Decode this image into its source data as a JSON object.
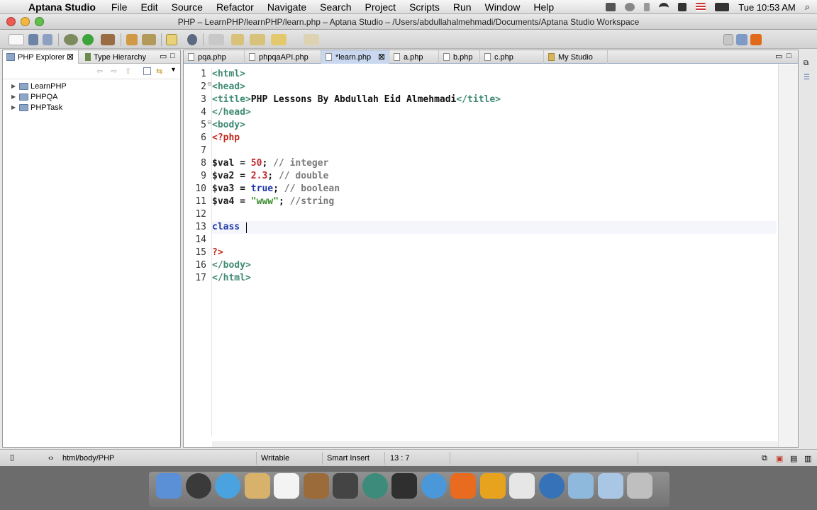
{
  "menubar": {
    "apple": "",
    "app_name": "Aptana Studio",
    "items": [
      "File",
      "Edit",
      "Source",
      "Refactor",
      "Navigate",
      "Search",
      "Project",
      "Scripts",
      "Run",
      "Window",
      "Help"
    ],
    "clock": "Tue 10:53 AM"
  },
  "window": {
    "title": "PHP – LearnPHP/learnPHP/learn.php – Aptana Studio – /Users/abdullahalmehmadi/Documents/Aptana Studio Workspace"
  },
  "left_panel": {
    "tabs": [
      {
        "label": "PHP Explorer",
        "active": true
      },
      {
        "label": "Type Hierarchy",
        "active": false
      }
    ],
    "tree": [
      "LearnPHP",
      "PHPQA",
      "PHPTask"
    ]
  },
  "editor": {
    "tabs": [
      {
        "label": "pqa.php",
        "active": false
      },
      {
        "label": "phpqaAPI.php",
        "active": false
      },
      {
        "label": "*learn.php",
        "active": true
      },
      {
        "label": "a.php",
        "active": false
      },
      {
        "label": "b.php",
        "active": false
      },
      {
        "label": "c.php",
        "active": false
      },
      {
        "label": "My Studio",
        "active": false
      }
    ],
    "current_line": 13,
    "lines": [
      [
        [
          "c-tag",
          "<html>"
        ]
      ],
      [
        [
          "c-tag",
          "<head>"
        ]
      ],
      [
        [
          "c-tag",
          "<title>"
        ],
        [
          "c-txt",
          "PHP Lessons By Abdullah Eid Almehmadi"
        ],
        [
          "c-tag",
          "</title>"
        ]
      ],
      [
        [
          "c-tag",
          "</head>"
        ]
      ],
      [
        [
          "c-tag",
          "<body>"
        ]
      ],
      [
        [
          "c-php",
          "<?php"
        ]
      ],
      [],
      [
        [
          "c-var",
          "$val"
        ],
        [
          "c-txt",
          " = "
        ],
        [
          "c-num",
          "50"
        ],
        [
          "c-txt",
          "; "
        ],
        [
          "c-cmt",
          "// integer"
        ]
      ],
      [
        [
          "c-var",
          "$va2"
        ],
        [
          "c-txt",
          " = "
        ],
        [
          "c-num",
          "2.3"
        ],
        [
          "c-txt",
          "; "
        ],
        [
          "c-cmt",
          "// double"
        ]
      ],
      [
        [
          "c-var",
          "$va3"
        ],
        [
          "c-txt",
          " = "
        ],
        [
          "c-kw",
          "true"
        ],
        [
          "c-txt",
          "; "
        ],
        [
          "c-cmt",
          "// boolean"
        ]
      ],
      [
        [
          "c-var",
          "$va4"
        ],
        [
          "c-txt",
          " = "
        ],
        [
          "c-str",
          "\"www\""
        ],
        [
          "c-txt",
          "; "
        ],
        [
          "c-cmt",
          "//string"
        ]
      ],
      [],
      [
        [
          "c-kw",
          "class"
        ]
      ],
      [],
      [
        [
          "c-php",
          "?>"
        ]
      ],
      [
        [
          "c-tag",
          "</body>"
        ]
      ],
      [
        [
          "c-tag",
          "</html>"
        ]
      ]
    ]
  },
  "statusbar": {
    "breadcrumb": "html/body/PHP",
    "mode": "Writable",
    "insert": "Smart Insert",
    "position": "13 : 7"
  },
  "colors": {
    "accent": "#c9d8ef",
    "tag": "#3e8a74",
    "php": "#c02a1d",
    "keyword": "#1d3aa8",
    "string": "#3b8b2c",
    "comment": "#7a7a7a"
  },
  "dock": {
    "icons": [
      "finder-icon",
      "system-prefs-wheel-icon",
      "safari-icon",
      "address-book-icon",
      "calendar-icon",
      "iphoto-icon",
      "star-icon",
      "time-machine-icon",
      "zoin-icon",
      "chat-icon",
      "firefox-icon",
      "settings-gear-icon",
      "adobe-icon",
      "network-icon",
      "applications-folder-icon",
      "documents-folder-icon",
      "trash-icon"
    ]
  }
}
